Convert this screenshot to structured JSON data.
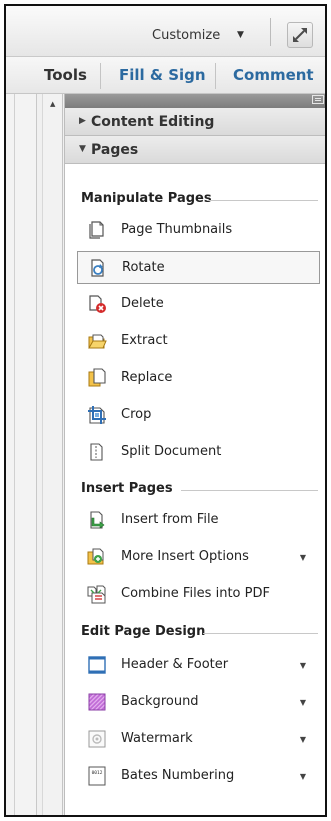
{
  "toolbar": {
    "customize_label": "Customize",
    "customize_caret": "▼",
    "expand_icon": "expand-window-icon"
  },
  "tabs": [
    {
      "label": "Tools",
      "active": true
    },
    {
      "label": "Fill & Sign"
    },
    {
      "label": "Comment"
    }
  ],
  "panel": {
    "sections": [
      {
        "label": "Content Editing",
        "expanded": false,
        "arrow": "▶"
      },
      {
        "label": "Pages",
        "expanded": true,
        "arrow": "▼"
      }
    ],
    "groups": [
      {
        "title": "Manipulate Pages",
        "items": [
          {
            "label": "Page Thumbnails",
            "icon": "page-thumbnails-icon"
          },
          {
            "label": "Rotate",
            "icon": "rotate-icon",
            "selected": true
          },
          {
            "label": "Delete",
            "icon": "delete-page-icon"
          },
          {
            "label": "Extract",
            "icon": "extract-icon"
          },
          {
            "label": "Replace",
            "icon": "replace-icon"
          },
          {
            "label": "Crop",
            "icon": "crop-icon"
          },
          {
            "label": "Split Document",
            "icon": "split-document-icon"
          }
        ]
      },
      {
        "title": "Insert Pages",
        "items": [
          {
            "label": "Insert from File",
            "icon": "insert-from-file-icon"
          },
          {
            "label": "More Insert Options",
            "icon": "more-insert-options-icon",
            "dropdown": "▼"
          },
          {
            "label": "Combine Files into PDF",
            "icon": "combine-files-icon"
          }
        ]
      },
      {
        "title": "Edit Page Design",
        "items": [
          {
            "label": "Header & Footer",
            "icon": "header-footer-icon",
            "dropdown": "▼"
          },
          {
            "label": "Background",
            "icon": "background-icon",
            "dropdown": "▼"
          },
          {
            "label": "Watermark",
            "icon": "watermark-icon",
            "dropdown": "▼"
          },
          {
            "label": "Bates Numbering",
            "icon": "bates-numbering-icon",
            "icon_text": "0012",
            "dropdown": "▼"
          }
        ]
      }
    ]
  },
  "colors": {
    "tab_active": "#333333",
    "tab_link": "#2c6aa0",
    "panel_header": "#8a8a8a",
    "selection_border": "#999999"
  }
}
